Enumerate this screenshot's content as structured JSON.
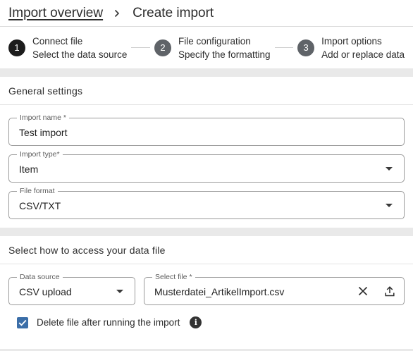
{
  "breadcrumb": {
    "parent": "Import overview",
    "current": "Create import"
  },
  "stepper": {
    "steps": [
      {
        "number": "1",
        "title": "Connect file",
        "subtitle": "Select the data source"
      },
      {
        "number": "2",
        "title": "File configuration",
        "subtitle": "Specify the formatting"
      },
      {
        "number": "3",
        "title": "Import options",
        "subtitle": "Add or replace data"
      }
    ]
  },
  "general": {
    "title": "General settings",
    "import_name": {
      "label": "Import name *",
      "value": "Test import"
    },
    "import_type": {
      "label": "Import type*",
      "value": "Item"
    },
    "file_format": {
      "label": "File format",
      "value": "CSV/TXT"
    }
  },
  "access": {
    "title": "Select how to access your data file",
    "data_source": {
      "label": "Data source",
      "value": "CSV upload"
    },
    "select_file": {
      "label": "Select file *",
      "value": "Musterdatei_ArtikelImport.csv"
    },
    "delete_after": {
      "label": "Delete file after running the import",
      "checked": true
    }
  },
  "icons": {
    "separator": "chevron-right-icon",
    "dropdown": "caret-down-icon",
    "clear": "close-icon",
    "upload": "upload-icon",
    "info": "info-icon",
    "check": "check-icon"
  },
  "colors": {
    "active_step": "#1c1c1c",
    "inactive_step": "#5f6368",
    "checkbox": "#3b6ea8",
    "band": "#e9e9e9"
  }
}
